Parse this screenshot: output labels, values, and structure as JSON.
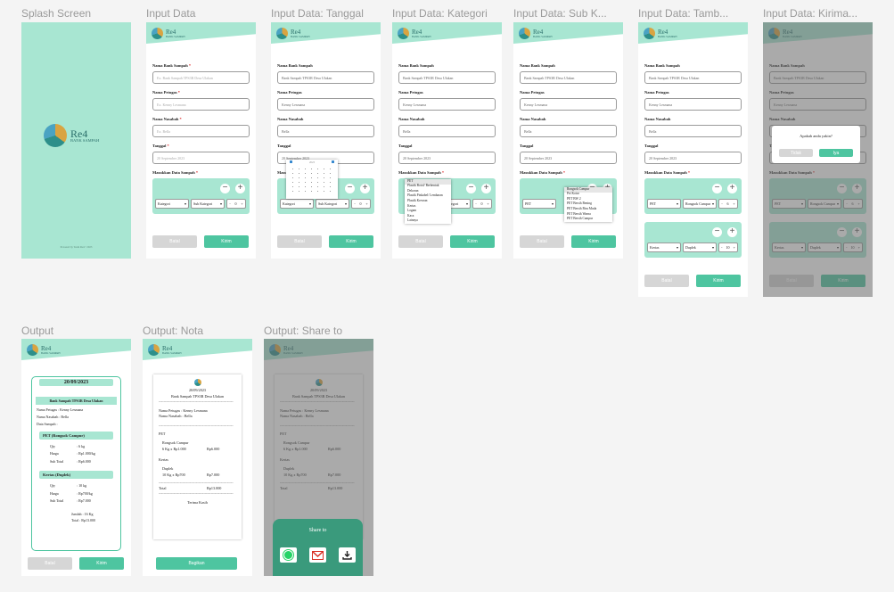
{
  "frames": {
    "splash": {
      "title": "Splash Screen",
      "brand": "Re4",
      "brand_sub": "BANK SAMPAH",
      "footer": "Powered by Team Re4 • 2023"
    },
    "input": {
      "title": "Input Data"
    },
    "tanggal": {
      "title": "Input Data: Tanggal"
    },
    "kategori": {
      "title": "Input Data: Kategori"
    },
    "subkategori": {
      "title": "Input Data: Sub K..."
    },
    "tambah": {
      "title": "Input Data: Tamb..."
    },
    "kirim": {
      "title": "Input Data: Kirima..."
    },
    "output": {
      "title": "Output"
    },
    "nota": {
      "title": "Output: Nota"
    },
    "share": {
      "title": "Output: Share to"
    }
  },
  "logo": {
    "name": "Re4",
    "sub": "BANK SAMPAH"
  },
  "form": {
    "bank_label": "Nama Bank Sampah",
    "petugas_label": "Nama Petugas",
    "nasabah_label": "Nama Nasabah",
    "tanggal_label": "Tanggal",
    "sampah_label": "Masukkan Data Sampah",
    "req": "*",
    "bank_ph": "Ex. Bank Sampah TPS3R Desa Ulakan",
    "petugas_ph": "Ex. Kenny Lesmana",
    "nasabah_ph": "Ex. Bella",
    "tanggal_ph": "20 September 2023",
    "bank_val": "Bank Sampah TPS3R Desa Ulakan",
    "petugas_val": "Kenny Lesmana",
    "nasabah_val": "Bella",
    "tanggal_val": "20 September 2023",
    "kategori": "Kategori",
    "subkategori": "Sub Kategori",
    "qty": "0",
    "batal": "Batal",
    "kirim": "Kirim",
    "kirim_alt": "Kirim"
  },
  "calendar": {
    "month": "2023"
  },
  "kategori_options": [
    "PET",
    "Plastik Botol/ Berbentuk",
    "Dekoran",
    "Plastik Pinkabel/ Lembaran",
    "Plastik Kresean",
    "Kertas",
    "Logam",
    "Kaca",
    "Lainnya"
  ],
  "sub_options": [
    "Rongsok Campur",
    "Pet Kotor",
    "PET BW 2",
    "PET Bersih Bening",
    "PET Bersih Biru Muda",
    "PET Bersih Warna",
    "PET Bersih Campur"
  ],
  "tambah": {
    "kat1": "PET",
    "sub1": "Rongsok Campur",
    "qty1": "6",
    "kat2": "Kertas",
    "sub2": "Duplek",
    "qty2": "10"
  },
  "dialog": {
    "question": "Apakah anda yakin?",
    "no": "Tidak",
    "yes": "Iya"
  },
  "output": {
    "date": "20/09/2023",
    "bank": "Bank Sampah TPS3R Desa Ulakan",
    "petugas": "Nama Petugas : Kenny Lesmana",
    "nasabah": "Nama Nasabah : Bella",
    "data_sampah": "Data Sampah :",
    "item1_title": "PET (Rongsok Campur)",
    "item2_title": "Kertas (Duplek)",
    "qty_l": "Qty",
    "harga_l": "Harga",
    "sub_l": "Sub Total",
    "i1_qty": ": 6 kg",
    "i1_harga": ": Rp1.000/kg",
    "i1_sub": ": Rp6.000",
    "i2_qty": ": 10 kg",
    "i2_harga": ": Rp700/kg",
    "i2_sub": ": Rp7.000",
    "jumlah": "Jumlah : 16 Kg",
    "total": "Total : Rp13.000",
    "batal": "Batal",
    "kirim": "Kirim"
  },
  "nota": {
    "date": "20/09/2023",
    "bank": "Bank Sampah TPS3R Desa Ulakan",
    "petugas": "Nama Petugas : Kenny Lesmana",
    "nasabah": "Nama Nasabah : Bella",
    "pet": "PET",
    "pet_sub": "Rongsok Campur",
    "pet_line": "6 Kg x Rp1.000",
    "pet_amt": "Rp6.000",
    "kertas": "Kertas",
    "kertas_sub": "Duplek",
    "kertas_line": "10 Kg x Rp700",
    "kertas_amt": "Rp7.000",
    "total_l": "Total",
    "total_v": "Rp13.000",
    "thanks": "Terima Kasih",
    "bagikan": "Bagikan",
    "dash": "------------------------------------------------------------"
  },
  "share": {
    "title": "Share to"
  },
  "colors": {
    "mint": "#a8e6d2",
    "teal": "#4ec5a0",
    "dark_teal": "#3a9a7c",
    "splash_bg": "#a8e6d2"
  }
}
